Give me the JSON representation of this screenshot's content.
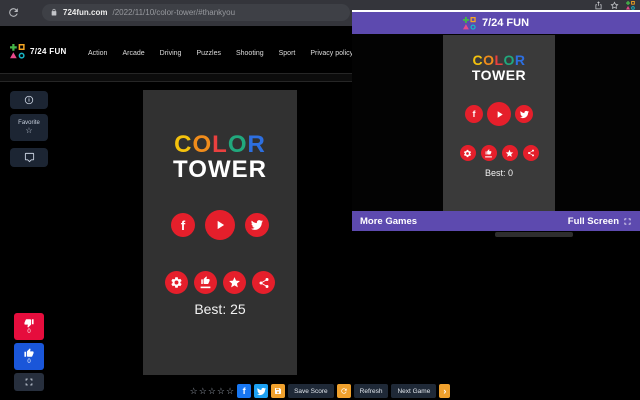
{
  "browser": {
    "url_domain": "724fun.com",
    "url_path": "/2022/11/10/color-tower/#thankyou"
  },
  "header": {
    "brand": "7/24 FUN",
    "nav": [
      "Action",
      "Arcade",
      "Driving",
      "Puzzles",
      "Shooting",
      "Sport",
      "Privacy policy"
    ]
  },
  "side_tools": {
    "favorite_label": "Favorite"
  },
  "main_game": {
    "letters": [
      {
        "ch": "C",
        "color": "#f4c20d"
      },
      {
        "ch": "O",
        "color": "#f08c1b"
      },
      {
        "ch": "L",
        "color": "#ea403f"
      },
      {
        "ch": "O",
        "color": "#21a87d"
      },
      {
        "ch": "R",
        "color": "#2d6fe0"
      }
    ],
    "tower": "TOWER",
    "best": "Best: 25"
  },
  "vote": {
    "dislike_count": "0",
    "like_count": "0"
  },
  "toolbar": {
    "save_score": "Save Score",
    "refresh": "Refresh",
    "next_game": "Next Game"
  },
  "popup": {
    "brand": "7/24 FUN",
    "more_games": "More Games",
    "full_screen": "Full Screen",
    "game": {
      "letters": [
        {
          "ch": "C",
          "color": "#f4c20d"
        },
        {
          "ch": "O",
          "color": "#f08c1b"
        },
        {
          "ch": "L",
          "color": "#ea403f"
        },
        {
          "ch": "O",
          "color": "#21a87d"
        },
        {
          "ch": "R",
          "color": "#2d6fe0"
        }
      ],
      "tower": "TOWER",
      "best": "Best: 0"
    }
  },
  "icons": {
    "star_outline": "☆",
    "facebook_letter": "f",
    "chevron_right": "›"
  },
  "colors": {
    "accent_purple": "#5d4aaf",
    "game_button_red": "#e51f2b",
    "like_blue": "#1a56d9",
    "dislike_red": "#e60d3d",
    "orange": "#f0a12d",
    "facebook_blue": "#1877f2",
    "twitter_blue": "#1da1f2"
  }
}
